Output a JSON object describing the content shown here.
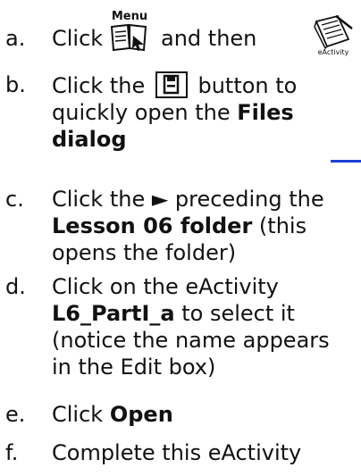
{
  "steps": [
    {
      "marker": "a.",
      "click": "Click",
      "and_then": "and then",
      "menu_icon": {
        "label": "Menu",
        "icon": "menu-book-icon"
      },
      "eactivity_icon": {
        "label": "eActivity",
        "icon": "eactivity-notebook-icon"
      }
    },
    {
      "marker": "b.",
      "line1a": "Click the",
      "line1b": "button to",
      "line2": "quickly open the",
      "bold1": "Files",
      "bold2": "dialog",
      "button_icon": "save-disk-icon"
    },
    {
      "marker": "c.",
      "line1": "Click the ► preceding the",
      "bold": "Lesson 06 folder",
      "rest1": "(this",
      "line3": "opens the folder)"
    },
    {
      "marker": "d.",
      "line1": "Click on the eActivity",
      "bold": "L6_PartI_a",
      "rest": "to select it",
      "line3": "(notice the name appears",
      "line4": "in the Edit box)"
    },
    {
      "marker": "e.",
      "text": "Click",
      "bold": "Open"
    },
    {
      "marker": "f.",
      "text": "Complete this eActivity"
    }
  ],
  "accent_color": "#1f3fd1"
}
